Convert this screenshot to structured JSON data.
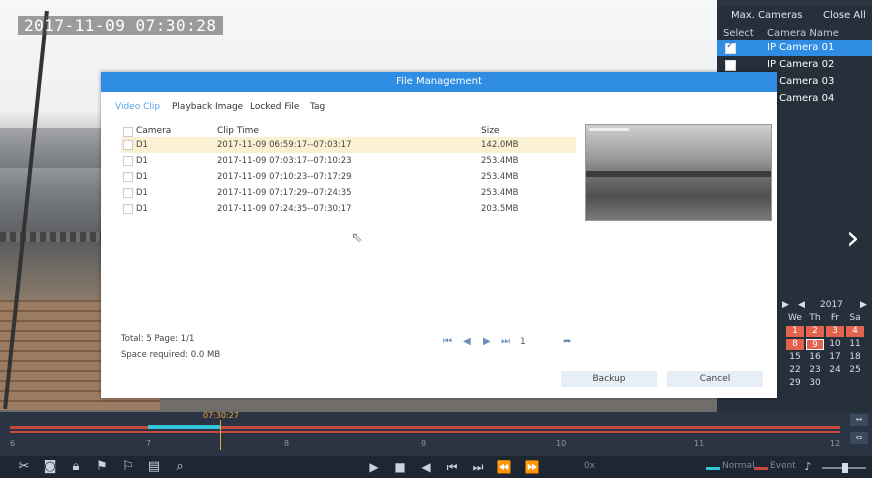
{
  "video": {
    "timestamp": "2017-11-09 07:30:28"
  },
  "camera_panel": {
    "max_cameras_label": "Max. Cameras",
    "close_all_label": "Close All",
    "col_select": "Select",
    "col_camera_name": "Camera Name",
    "cameras": [
      {
        "name": "IP Camera 01",
        "checked": true,
        "selected": true
      },
      {
        "name": "IP Camera 02",
        "checked": false,
        "selected": false
      },
      {
        "name": "IP Camera 03",
        "checked": false,
        "selected": false
      },
      {
        "name": "IP Camera 04",
        "checked": false,
        "selected": false
      }
    ],
    "next_icon": "chevron-right-icon"
  },
  "calendar": {
    "year": "2017",
    "weekdays": [
      "We",
      "Th",
      "Fr",
      "Sa"
    ],
    "rows": [
      [
        "1",
        "2",
        "3",
        "4"
      ],
      [
        "8",
        "9",
        "10",
        "11"
      ],
      [
        "15",
        "16",
        "17",
        "18"
      ],
      [
        "22",
        "23",
        "24",
        "25"
      ],
      [
        "29",
        "30"
      ]
    ],
    "highlight_color": "#e3624e"
  },
  "dialog": {
    "title": "File Management",
    "tabs": [
      "Video Clip",
      "Playback Image",
      "Locked File",
      "Tag"
    ],
    "active_tab": "Video Clip",
    "columns": [
      "Camera",
      "Clip Time",
      "Size"
    ],
    "rows": [
      {
        "camera": "D1",
        "clip_time": "2017-11-09 06:59:17--07:03:17",
        "size": "142.0MB"
      },
      {
        "camera": "D1",
        "clip_time": "2017-11-09 07:03:17--07:10:23",
        "size": "253.4MB"
      },
      {
        "camera": "D1",
        "clip_time": "2017-11-09 07:10:23--07:17:29",
        "size": "253.4MB"
      },
      {
        "camera": "D1",
        "clip_time": "2017-11-09 07:17:29--07:24:35",
        "size": "253.4MB"
      },
      {
        "camera": "D1",
        "clip_time": "2017-11-09 07:24:35--07:30:17",
        "size": "203.5MB"
      }
    ],
    "total_text": "Total: 5  Page: 1/1",
    "space_text": "Space required: 0.0 MB",
    "page_number": "1",
    "backup_label": "Backup",
    "cancel_label": "Cancel",
    "accent_color": "#2f8de3"
  },
  "timeline": {
    "cursor_time": "07:30:27",
    "hour_ticks": [
      "6",
      "7",
      "8",
      "9",
      "10",
      "11",
      "12"
    ]
  },
  "toolbar": {
    "speed_label": "0x",
    "legend_normal": "Normal",
    "legend_event": "Event"
  }
}
